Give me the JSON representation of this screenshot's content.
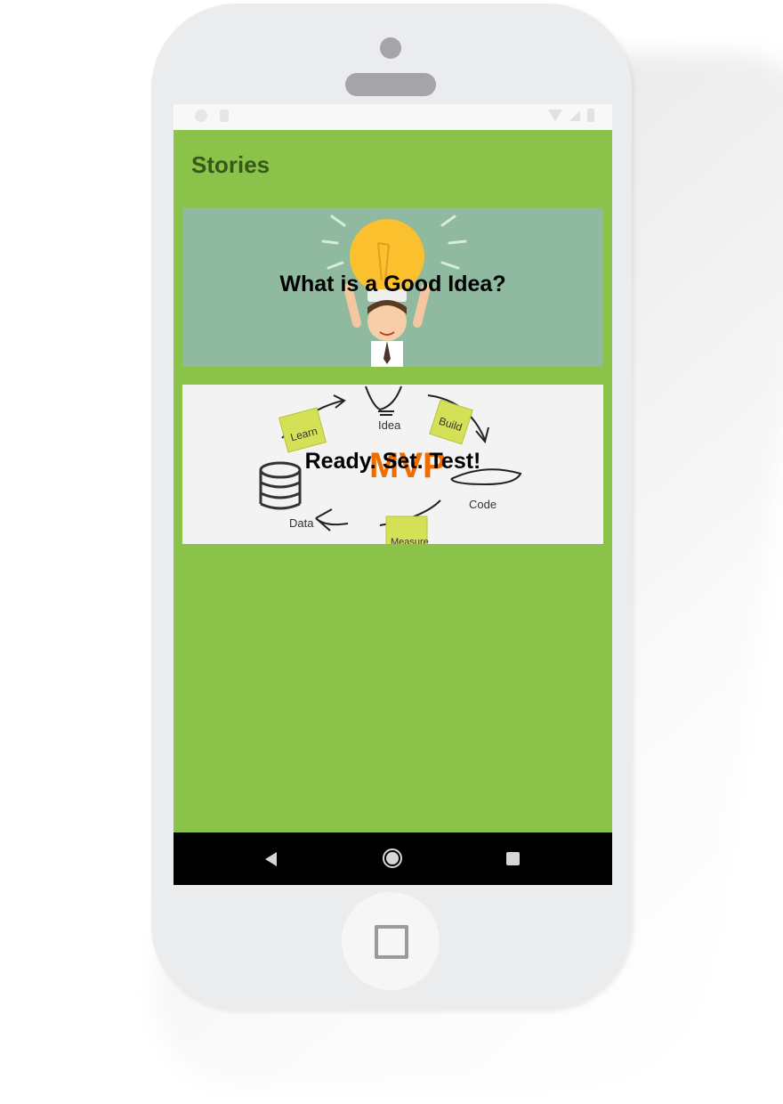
{
  "app": {
    "title": "Stories"
  },
  "stories": [
    {
      "title": "What is a Good Idea?",
      "image_icon": "lightbulb-person-illustration"
    },
    {
      "title": "Ready. Set. Test!",
      "image_icon": "mvp-cycle-illustration",
      "diagram_labels": [
        "Idea",
        "Build",
        "Code",
        "Measure",
        "Data",
        "Learn",
        "MVP"
      ]
    }
  ],
  "colors": {
    "app_background": "#8bc34a",
    "title_text": "#37581a",
    "card1_background": "#8fba9f",
    "card2_background": "#f3f3f4",
    "nav_bar": "#000000"
  },
  "navbar": {
    "back_icon": "back-icon",
    "home_icon": "home-icon",
    "recents_icon": "recents-icon"
  }
}
